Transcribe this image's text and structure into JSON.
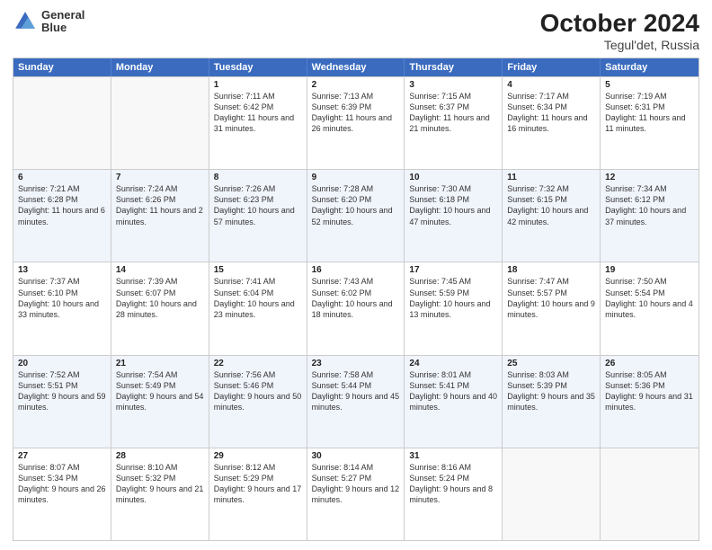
{
  "header": {
    "logo_line1": "General",
    "logo_line2": "Blue",
    "title": "October 2024",
    "subtitle": "Tegul'det, Russia"
  },
  "days_of_week": [
    "Sunday",
    "Monday",
    "Tuesday",
    "Wednesday",
    "Thursday",
    "Friday",
    "Saturday"
  ],
  "weeks": [
    [
      {
        "day": "",
        "sunrise": "",
        "sunset": "",
        "daylight": ""
      },
      {
        "day": "",
        "sunrise": "",
        "sunset": "",
        "daylight": ""
      },
      {
        "day": "1",
        "sunrise": "Sunrise: 7:11 AM",
        "sunset": "Sunset: 6:42 PM",
        "daylight": "Daylight: 11 hours and 31 minutes."
      },
      {
        "day": "2",
        "sunrise": "Sunrise: 7:13 AM",
        "sunset": "Sunset: 6:39 PM",
        "daylight": "Daylight: 11 hours and 26 minutes."
      },
      {
        "day": "3",
        "sunrise": "Sunrise: 7:15 AM",
        "sunset": "Sunset: 6:37 PM",
        "daylight": "Daylight: 11 hours and 21 minutes."
      },
      {
        "day": "4",
        "sunrise": "Sunrise: 7:17 AM",
        "sunset": "Sunset: 6:34 PM",
        "daylight": "Daylight: 11 hours and 16 minutes."
      },
      {
        "day": "5",
        "sunrise": "Sunrise: 7:19 AM",
        "sunset": "Sunset: 6:31 PM",
        "daylight": "Daylight: 11 hours and 11 minutes."
      }
    ],
    [
      {
        "day": "6",
        "sunrise": "Sunrise: 7:21 AM",
        "sunset": "Sunset: 6:28 PM",
        "daylight": "Daylight: 11 hours and 6 minutes."
      },
      {
        "day": "7",
        "sunrise": "Sunrise: 7:24 AM",
        "sunset": "Sunset: 6:26 PM",
        "daylight": "Daylight: 11 hours and 2 minutes."
      },
      {
        "day": "8",
        "sunrise": "Sunrise: 7:26 AM",
        "sunset": "Sunset: 6:23 PM",
        "daylight": "Daylight: 10 hours and 57 minutes."
      },
      {
        "day": "9",
        "sunrise": "Sunrise: 7:28 AM",
        "sunset": "Sunset: 6:20 PM",
        "daylight": "Daylight: 10 hours and 52 minutes."
      },
      {
        "day": "10",
        "sunrise": "Sunrise: 7:30 AM",
        "sunset": "Sunset: 6:18 PM",
        "daylight": "Daylight: 10 hours and 47 minutes."
      },
      {
        "day": "11",
        "sunrise": "Sunrise: 7:32 AM",
        "sunset": "Sunset: 6:15 PM",
        "daylight": "Daylight: 10 hours and 42 minutes."
      },
      {
        "day": "12",
        "sunrise": "Sunrise: 7:34 AM",
        "sunset": "Sunset: 6:12 PM",
        "daylight": "Daylight: 10 hours and 37 minutes."
      }
    ],
    [
      {
        "day": "13",
        "sunrise": "Sunrise: 7:37 AM",
        "sunset": "Sunset: 6:10 PM",
        "daylight": "Daylight: 10 hours and 33 minutes."
      },
      {
        "day": "14",
        "sunrise": "Sunrise: 7:39 AM",
        "sunset": "Sunset: 6:07 PM",
        "daylight": "Daylight: 10 hours and 28 minutes."
      },
      {
        "day": "15",
        "sunrise": "Sunrise: 7:41 AM",
        "sunset": "Sunset: 6:04 PM",
        "daylight": "Daylight: 10 hours and 23 minutes."
      },
      {
        "day": "16",
        "sunrise": "Sunrise: 7:43 AM",
        "sunset": "Sunset: 6:02 PM",
        "daylight": "Daylight: 10 hours and 18 minutes."
      },
      {
        "day": "17",
        "sunrise": "Sunrise: 7:45 AM",
        "sunset": "Sunset: 5:59 PM",
        "daylight": "Daylight: 10 hours and 13 minutes."
      },
      {
        "day": "18",
        "sunrise": "Sunrise: 7:47 AM",
        "sunset": "Sunset: 5:57 PM",
        "daylight": "Daylight: 10 hours and 9 minutes."
      },
      {
        "day": "19",
        "sunrise": "Sunrise: 7:50 AM",
        "sunset": "Sunset: 5:54 PM",
        "daylight": "Daylight: 10 hours and 4 minutes."
      }
    ],
    [
      {
        "day": "20",
        "sunrise": "Sunrise: 7:52 AM",
        "sunset": "Sunset: 5:51 PM",
        "daylight": "Daylight: 9 hours and 59 minutes."
      },
      {
        "day": "21",
        "sunrise": "Sunrise: 7:54 AM",
        "sunset": "Sunset: 5:49 PM",
        "daylight": "Daylight: 9 hours and 54 minutes."
      },
      {
        "day": "22",
        "sunrise": "Sunrise: 7:56 AM",
        "sunset": "Sunset: 5:46 PM",
        "daylight": "Daylight: 9 hours and 50 minutes."
      },
      {
        "day": "23",
        "sunrise": "Sunrise: 7:58 AM",
        "sunset": "Sunset: 5:44 PM",
        "daylight": "Daylight: 9 hours and 45 minutes."
      },
      {
        "day": "24",
        "sunrise": "Sunrise: 8:01 AM",
        "sunset": "Sunset: 5:41 PM",
        "daylight": "Daylight: 9 hours and 40 minutes."
      },
      {
        "day": "25",
        "sunrise": "Sunrise: 8:03 AM",
        "sunset": "Sunset: 5:39 PM",
        "daylight": "Daylight: 9 hours and 35 minutes."
      },
      {
        "day": "26",
        "sunrise": "Sunrise: 8:05 AM",
        "sunset": "Sunset: 5:36 PM",
        "daylight": "Daylight: 9 hours and 31 minutes."
      }
    ],
    [
      {
        "day": "27",
        "sunrise": "Sunrise: 8:07 AM",
        "sunset": "Sunset: 5:34 PM",
        "daylight": "Daylight: 9 hours and 26 minutes."
      },
      {
        "day": "28",
        "sunrise": "Sunrise: 8:10 AM",
        "sunset": "Sunset: 5:32 PM",
        "daylight": "Daylight: 9 hours and 21 minutes."
      },
      {
        "day": "29",
        "sunrise": "Sunrise: 8:12 AM",
        "sunset": "Sunset: 5:29 PM",
        "daylight": "Daylight: 9 hours and 17 minutes."
      },
      {
        "day": "30",
        "sunrise": "Sunrise: 8:14 AM",
        "sunset": "Sunset: 5:27 PM",
        "daylight": "Daylight: 9 hours and 12 minutes."
      },
      {
        "day": "31",
        "sunrise": "Sunrise: 8:16 AM",
        "sunset": "Sunset: 5:24 PM",
        "daylight": "Daylight: 9 hours and 8 minutes."
      },
      {
        "day": "",
        "sunrise": "",
        "sunset": "",
        "daylight": ""
      },
      {
        "day": "",
        "sunrise": "",
        "sunset": "",
        "daylight": ""
      }
    ]
  ]
}
